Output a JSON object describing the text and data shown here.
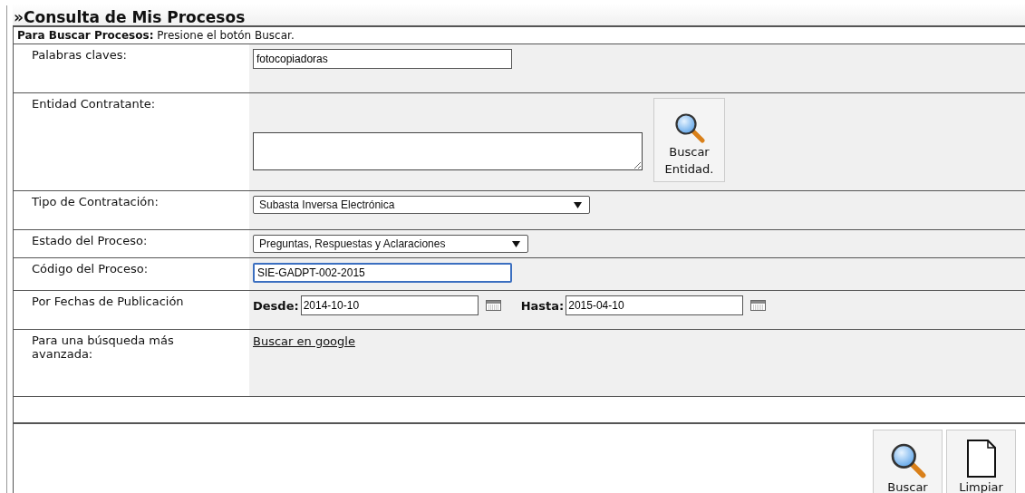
{
  "title": "»Consulta de Mis Procesos",
  "instruction": {
    "label": "Para Buscar Procesos:",
    "text": "Presione el botón Buscar."
  },
  "fields": [
    {
      "kind": "text",
      "label": "Palabras claves:",
      "value": "fotocopiadoras",
      "focused": false
    },
    {
      "kind": "textarea",
      "label": "Entidad Contratante:",
      "button": "Buscar Entidad."
    },
    {
      "kind": "select",
      "label": "Tipo de Contratación:",
      "value": "Subasta Inversa Electrónica",
      "wide": true
    },
    {
      "kind": "select",
      "label": "Estado del Proceso:",
      "value": "Preguntas, Respuestas y Aclaraciones",
      "wide": false
    },
    {
      "kind": "text",
      "label": "Código del Proceso:",
      "value": "SIE-GADPT-002-2015",
      "focused": true
    },
    {
      "kind": "dates",
      "label": "Por Fechas de Publicación",
      "from_label": "Desde:",
      "from": "2014-10-10",
      "to_label": "Hasta:",
      "to": "2015-04-10"
    },
    {
      "kind": "link",
      "label": "Para una búsqueda más avanzada:",
      "link": "Buscar en google"
    }
  ],
  "actions": [
    {
      "kind": "search",
      "label": "Buscar"
    },
    {
      "kind": "clear",
      "label": "Limpiar"
    }
  ]
}
